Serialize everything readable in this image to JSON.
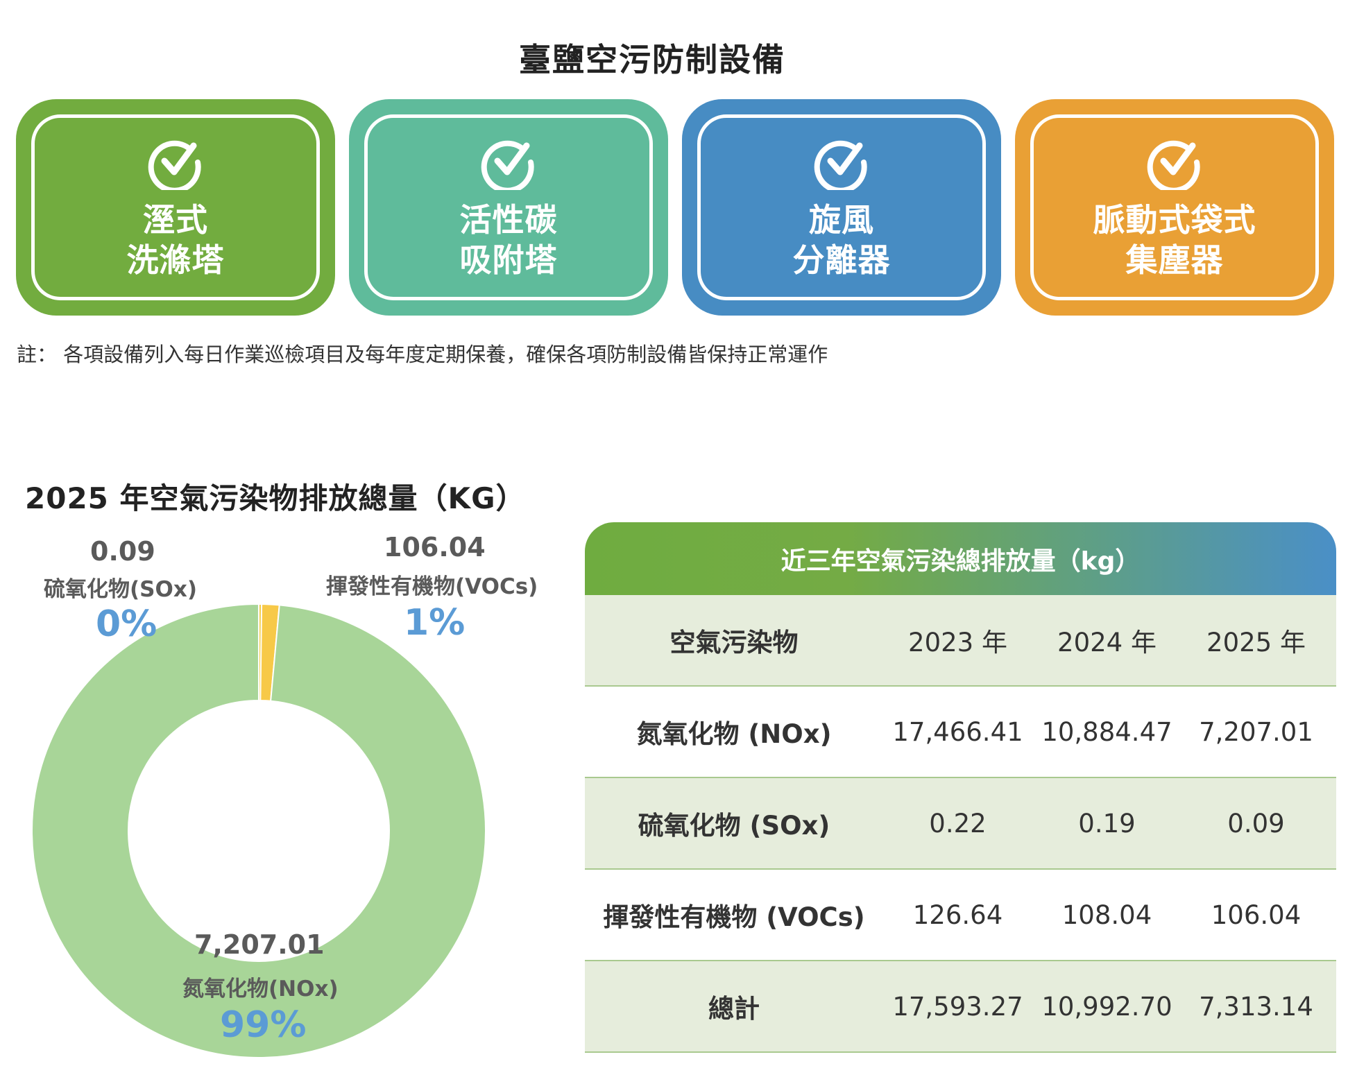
{
  "header": {
    "title": "臺鹽空污防制設備"
  },
  "cards": [
    {
      "line1": "溼式",
      "line2": "洗滌塔",
      "color": "#72ac3f",
      "icon": "check-circle-icon"
    },
    {
      "line1": "活性碳",
      "line2": "吸附塔",
      "color": "#5fbb9b",
      "icon": "check-circle-icon"
    },
    {
      "line1": "旋風",
      "line2": "分離器",
      "color": "#478cc3",
      "icon": "check-circle-icon"
    },
    {
      "line1": "脈動式袋式",
      "line2": "集塵器",
      "color": "#e9a035",
      "icon": "check-circle-icon"
    }
  ],
  "note": "註： 各項設備列入每日作業巡檢項目及每年度定期保養，確保各項防制設備皆保持正常運作",
  "chart_data": {
    "type": "pie",
    "title": "2025 年空氣污染物排放總量（KG）",
    "slices": [
      {
        "name": "氮氧化物(NOx)",
        "value": 7207.01,
        "value_label": "7,207.01",
        "percent": "99%",
        "color": "#a8d598"
      },
      {
        "name": "硫氧化物(SOx)",
        "value": 0.09,
        "value_label": "0.09",
        "percent": "0%",
        "color": "#f2cc4a"
      },
      {
        "name": "揮發性有機物(VOCs)",
        "value": 106.04,
        "value_label": "106.04",
        "percent": "1%",
        "color": "#f7c948"
      }
    ]
  },
  "table": {
    "title": "近三年空氣污染總排放量（kg）",
    "headers": [
      "空氣污染物",
      "2023 年",
      "2024 年",
      "2025 年"
    ],
    "rows": [
      [
        "氮氧化物 (NOx)",
        "17,466.41",
        "10,884.47",
        "7,207.01"
      ],
      [
        "硫氧化物 (SOx)",
        "0.22",
        "0.19",
        "0.09"
      ],
      [
        "揮發性有機物 (VOCs)",
        "126.64",
        "108.04",
        "106.04"
      ],
      [
        "總計",
        "17,593.27",
        "10,992.70",
        "7,313.14"
      ]
    ]
  }
}
